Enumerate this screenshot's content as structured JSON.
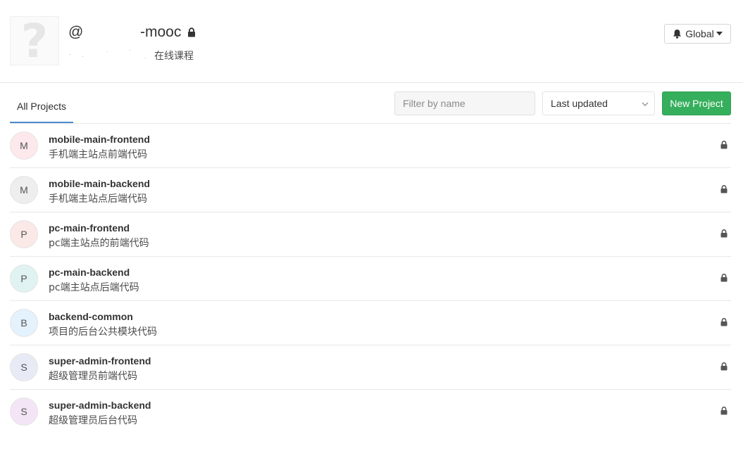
{
  "group": {
    "name_prefix": "@",
    "name_suffix": "-mooc",
    "description": "在线课程"
  },
  "notifications": {
    "label": "Global"
  },
  "tabs": {
    "all_projects": "All Projects"
  },
  "filter": {
    "placeholder": "Filter by name"
  },
  "sort": {
    "selected": "Last updated"
  },
  "new_project": {
    "label": "New Project"
  },
  "projects": [
    {
      "initial": "M",
      "name": "mobile-main-frontend",
      "description": "手机端主站点前端代码",
      "avatar_color": "#fde8ec"
    },
    {
      "initial": "M",
      "name": "mobile-main-backend",
      "description": "手机端主站点后端代码",
      "avatar_color": "#eeeeee"
    },
    {
      "initial": "P",
      "name": "pc-main-frontend",
      "description": "pc端主站点的前端代码",
      "avatar_color": "#fbe9e7"
    },
    {
      "initial": "P",
      "name": "pc-main-backend",
      "description": "pc端主站点后端代码",
      "avatar_color": "#e0f2f1"
    },
    {
      "initial": "B",
      "name": "backend-common",
      "description": "项目的后台公共模块代码",
      "avatar_color": "#e3f2fd"
    },
    {
      "initial": "S",
      "name": "super-admin-frontend",
      "description": "超级管理员前端代码",
      "avatar_color": "#e8eaf6"
    },
    {
      "initial": "S",
      "name": "super-admin-backend",
      "description": "超级管理员后台代码",
      "avatar_color": "#f3e5f5"
    }
  ]
}
